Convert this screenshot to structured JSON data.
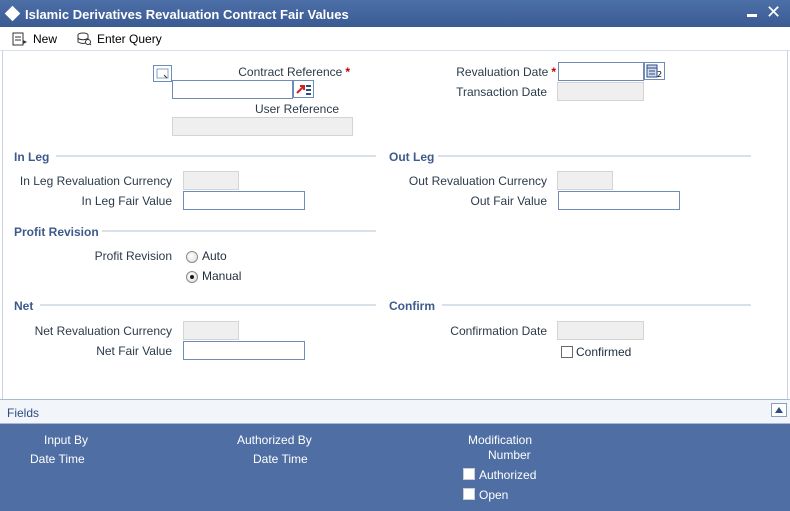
{
  "window": {
    "title": "Islamic Derivatives Revaluation Contract Fair Values"
  },
  "toolbar": {
    "new_label": "New",
    "enter_query_label": "Enter Query"
  },
  "header": {
    "contract_reference_label": "Contract Reference",
    "user_reference_label": "User Reference",
    "revaluation_date_label": "Revaluation Date",
    "transaction_date_label": "Transaction Date",
    "required_marker": "*",
    "contract_reference_value": "",
    "user_reference_value": "",
    "revaluation_date_value": "",
    "transaction_date_value": ""
  },
  "in_leg": {
    "section_title": "In Leg",
    "currency_label": "In Leg Revaluation Currency",
    "fair_value_label": "In Leg Fair Value",
    "currency_value": "",
    "fair_value": ""
  },
  "out_leg": {
    "section_title": "Out Leg",
    "currency_label": "Out Revaluation Currency",
    "fair_value_label": "Out Fair Value",
    "currency_value": "",
    "fair_value": ""
  },
  "profit_revision": {
    "section_title": "Profit Revision",
    "field_label": "Profit Revision",
    "options": [
      "Auto",
      "Manual"
    ],
    "selected": "Manual"
  },
  "net": {
    "section_title": "Net",
    "currency_label": "Net Revaluation Currency",
    "fair_value_label": "Net Fair Value",
    "currency_value": "",
    "fair_value": ""
  },
  "confirm": {
    "section_title": "Confirm",
    "date_label": "Confirmation Date",
    "date_value": "",
    "confirmed_label": "Confirmed",
    "confirmed": false
  },
  "footer": {
    "fields_label": "Fields"
  },
  "audit": {
    "input_by_label": "Input By",
    "input_date_time_label": "Date Time",
    "authorized_by_label": "Authorized By",
    "authorized_date_time_label": "Date Time",
    "modification_label_line1": "Modification",
    "modification_label_line2": "Number",
    "authorized_check_label": "Authorized",
    "open_check_label": "Open",
    "authorized_checked": false,
    "open_checked": false
  },
  "colors": {
    "title_bar": "#3a5a92",
    "audit_panel": "#4e6ea4",
    "section_header": "#3d5a8a",
    "required": "#c00000"
  }
}
